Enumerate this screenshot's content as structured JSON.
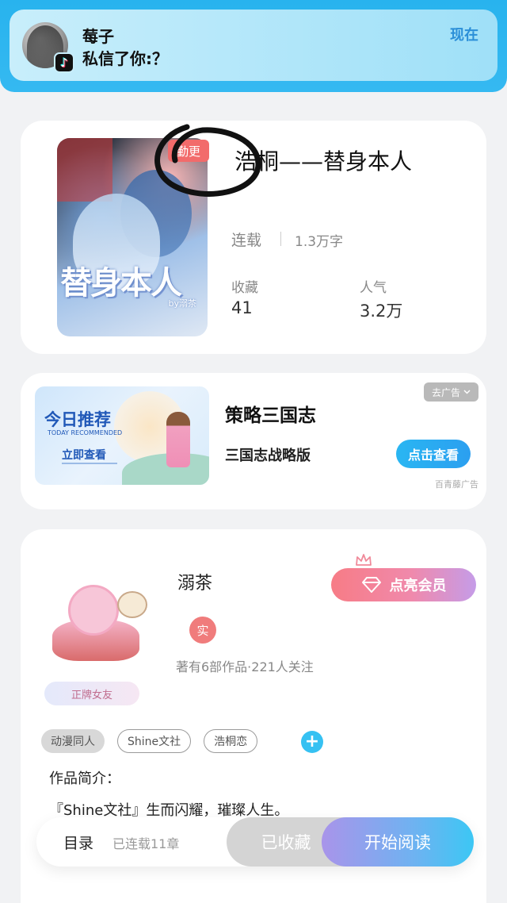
{
  "notification": {
    "sender": "莓子",
    "message": "私信了你:？",
    "time": "现在",
    "app_icon_glyph": "♪"
  },
  "book": {
    "title": "浩桐——替身本人",
    "badge": "勤更",
    "cover_title": "替身本人",
    "cover_author": "by溺茶",
    "status": "连载",
    "word_count": "1.3万字",
    "stats": [
      {
        "label": "收藏",
        "value": "41"
      },
      {
        "label": "人气",
        "value": "3.2万"
      }
    ]
  },
  "ad": {
    "image_headline": "今日推荐",
    "image_subtitle": "TODAY RECOMMENDED",
    "image_cta": "立即查看",
    "title": "策略三国志",
    "description": "三国志战略版",
    "remove_label": "去广告",
    "button_label": "点击查看",
    "source": "百青藤广告"
  },
  "author": {
    "name": "溺茶",
    "verified_label": "实",
    "meta": "著有6部作品·221人关注",
    "avatar_tag": "正牌女友",
    "vip_button": "点亮会员",
    "tags": [
      "动漫同人",
      "Shine文社",
      "浩桐恋"
    ],
    "add_tag_symbol": "+",
    "intro_label": "作品简介：",
    "intro_text": "『Shine文社』生而闪耀，璀璨人生。"
  },
  "bottom_bar": {
    "catalog": "目录",
    "chapters": "已连载11章",
    "collected": "已收藏",
    "read": "开始阅读"
  },
  "colors": {
    "banner_blue": "#28b3ee",
    "accent_red": "#f26b6b",
    "accent_blue": "#2ab6f2",
    "vip_gradient_start": "#f77c86",
    "vip_gradient_end": "#c59ce8"
  }
}
